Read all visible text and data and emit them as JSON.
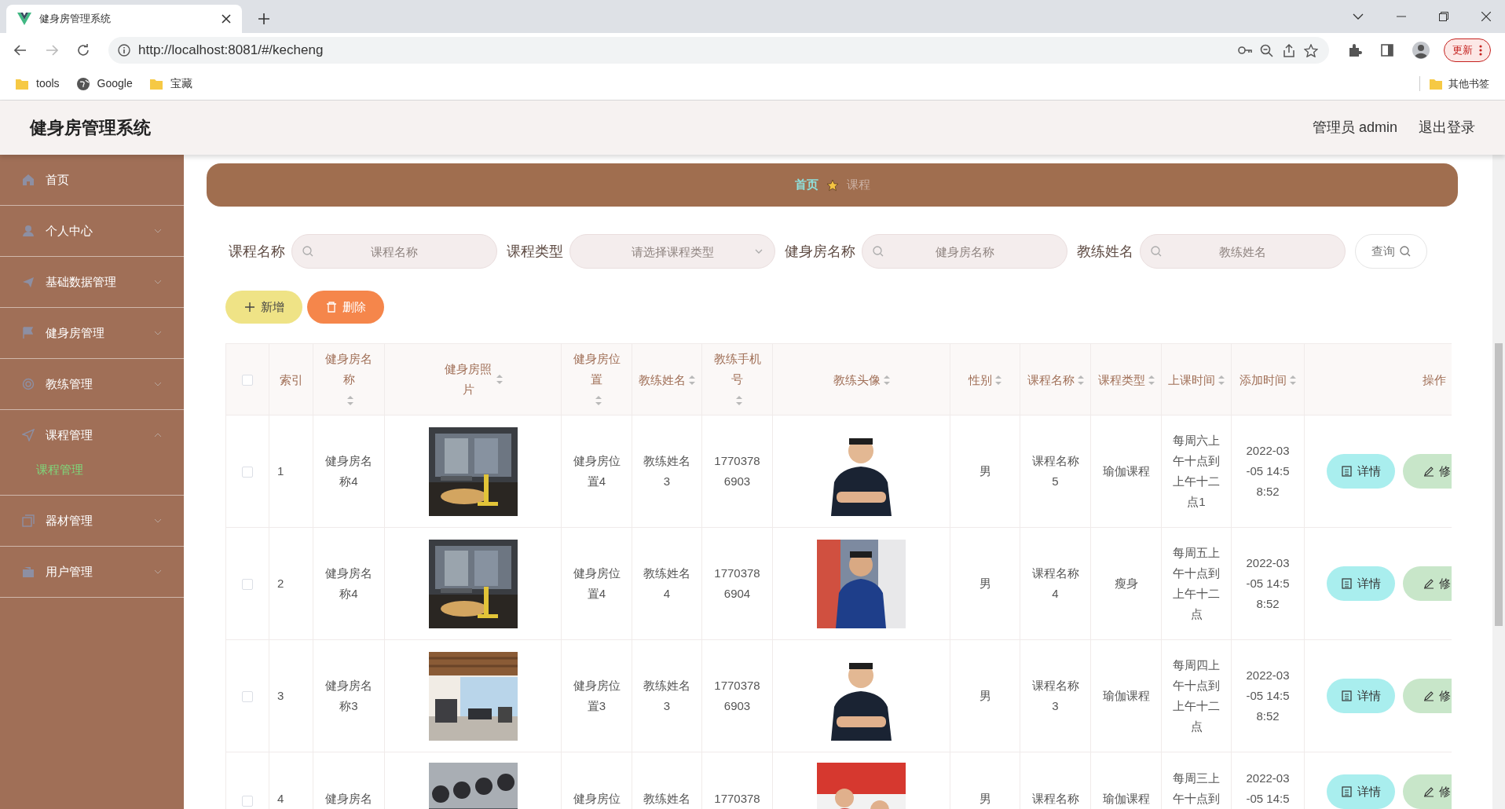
{
  "browser": {
    "tab_title": "健身房管理系统",
    "url": "http://localhost:8081/#/kecheng",
    "update_button": "更新",
    "bookmarks": [
      {
        "label": "tools",
        "kind": "folder"
      },
      {
        "label": "Google",
        "kind": "site"
      },
      {
        "label": "宝藏",
        "kind": "folder"
      }
    ],
    "other_bookmarks": "其他书签"
  },
  "app": {
    "title": "健身房管理系统",
    "user": "管理员 admin",
    "logout": "退出登录"
  },
  "sidebar": {
    "items": [
      {
        "label": "首页",
        "kind": "link"
      },
      {
        "label": "个人中心",
        "kind": "menu",
        "expanded": false
      },
      {
        "label": "基础数据管理",
        "kind": "menu",
        "expanded": false
      },
      {
        "label": "健身房管理",
        "kind": "menu",
        "expanded": false
      },
      {
        "label": "教练管理",
        "kind": "menu",
        "expanded": false
      },
      {
        "label": "课程管理",
        "kind": "menu",
        "expanded": true,
        "children": [
          {
            "label": "课程管理",
            "selected": true
          }
        ]
      },
      {
        "label": "器材管理",
        "kind": "menu",
        "expanded": false
      },
      {
        "label": "用户管理",
        "kind": "menu",
        "expanded": false
      }
    ]
  },
  "breadcrumb": [
    {
      "label": "首页",
      "selected": false
    },
    {
      "label": "课程",
      "selected": true
    }
  ],
  "search": {
    "fields": [
      {
        "label": "课程名称",
        "placeholder": "课程名称",
        "kind": "text"
      },
      {
        "label": "课程类型",
        "placeholder": "请选择课程类型",
        "kind": "select"
      },
      {
        "label": "健身房名称",
        "placeholder": "健身房名称",
        "kind": "text"
      },
      {
        "label": "教练姓名",
        "placeholder": "教练姓名",
        "kind": "text"
      }
    ],
    "button": "查询"
  },
  "actions": [
    {
      "label": "新增",
      "kind": "add"
    },
    {
      "label": "删除",
      "kind": "delete"
    }
  ],
  "table": {
    "select_all": false,
    "columns": [
      {
        "label": "索引",
        "sortable": false
      },
      {
        "label": "健身房名称",
        "sortable": true
      },
      {
        "label": "健身房照片",
        "sortable": true
      },
      {
        "label": "健身房位置",
        "sortable": true
      },
      {
        "label": "教练姓名",
        "sortable": true
      },
      {
        "label": "教练手机号",
        "sortable": true
      },
      {
        "label": "教练头像",
        "sortable": true
      },
      {
        "label": "性别",
        "sortable": true
      },
      {
        "label": "课程名称",
        "sortable": true
      },
      {
        "label": "课程类型",
        "sortable": true
      },
      {
        "label": "上课时间",
        "sortable": true
      },
      {
        "label": "添加时间",
        "sortable": true
      },
      {
        "label": "操作",
        "sortable": false
      }
    ],
    "rows": [
      {
        "checked": false,
        "cells": [
          "1",
          "健身房名称4",
          "",
          "健身房位置4",
          "教练姓名3",
          "17703786903",
          "",
          "男",
          "课程名称5",
          "瑜伽课程",
          "每周六上午十点到上午十二点1",
          "2022-03-05 14:58:52"
        ],
        "buttons": [
          {
            "label": "详情",
            "kind": "detail"
          },
          {
            "label": "修",
            "kind": "edit"
          }
        ]
      },
      {
        "checked": false,
        "cells": [
          "2",
          "健身房名称4",
          "",
          "健身房位置4",
          "教练姓名4",
          "17703786904",
          "",
          "男",
          "课程名称4",
          "瘦身",
          "每周五上午十点到上午十二点",
          "2022-03-05 14:58:52"
        ],
        "buttons": [
          {
            "label": "详情",
            "kind": "detail"
          },
          {
            "label": "修",
            "kind": "edit"
          }
        ]
      },
      {
        "checked": false,
        "cells": [
          "3",
          "健身房名称3",
          "",
          "健身房位置3",
          "教练姓名3",
          "17703786903",
          "",
          "男",
          "课程名称3",
          "瑜伽课程",
          "每周四上午十点到上午十二点",
          "2022-03-05 14:58:52"
        ],
        "buttons": [
          {
            "label": "详情",
            "kind": "detail"
          },
          {
            "label": "修",
            "kind": "edit"
          }
        ]
      },
      {
        "checked": false,
        "cells": [
          "4",
          "健身房名",
          "",
          "健身房位",
          "教练姓名",
          "1770378",
          "",
          "男",
          "课程名称",
          "瑜伽课程",
          "每周三上午十点到",
          "2022-03-05 14:5"
        ],
        "buttons": [
          {
            "label": "详情",
            "kind": "detail"
          },
          {
            "label": "修",
            "kind": "edit"
          }
        ]
      }
    ]
  }
}
